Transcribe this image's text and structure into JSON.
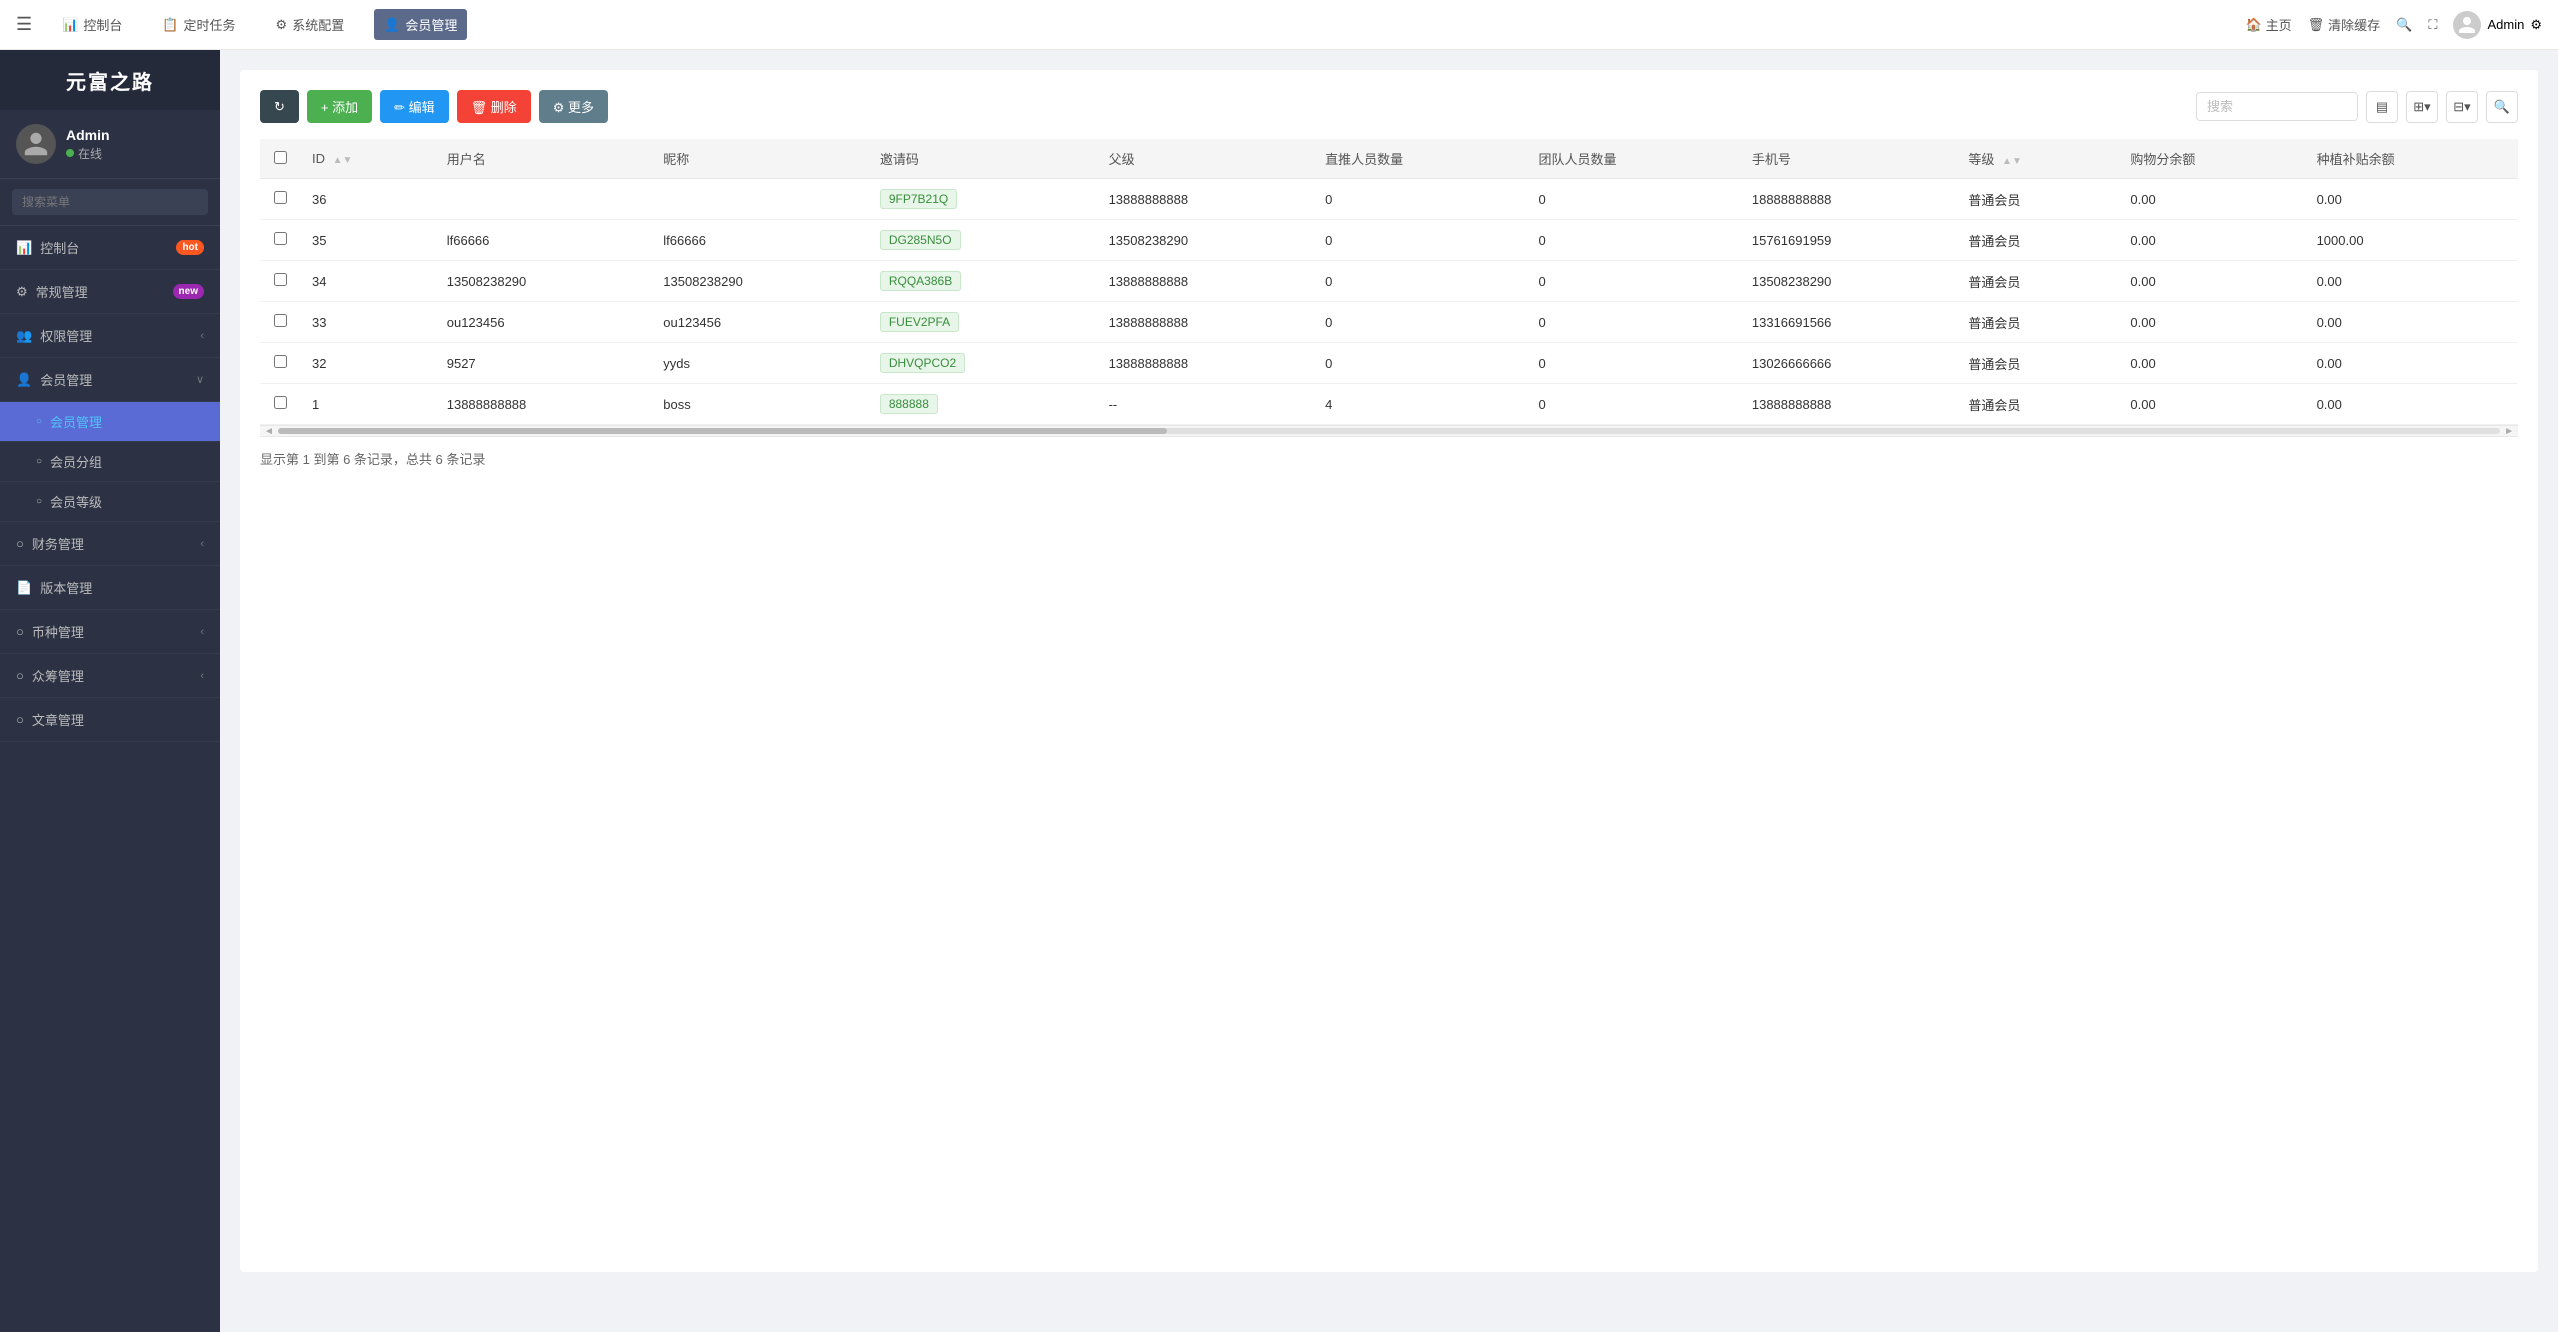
{
  "app": {
    "logo": "元富之路",
    "user": {
      "name": "Admin",
      "status": "在线"
    }
  },
  "topNav": {
    "hamburger": "☰",
    "items": [
      {
        "id": "dashboard",
        "icon": "📊",
        "label": "控制台"
      },
      {
        "id": "cron",
        "icon": "📋",
        "label": "定时任务"
      },
      {
        "id": "config",
        "icon": "⚙",
        "label": "系统配置"
      },
      {
        "id": "member",
        "icon": "👤",
        "label": "会员管理",
        "active": true
      }
    ],
    "right": [
      {
        "id": "home",
        "icon": "🏠",
        "label": "主页"
      },
      {
        "id": "clear",
        "icon": "🗑",
        "label": "清除缓存"
      },
      {
        "id": "extra1",
        "icon": "🔍",
        "label": ""
      },
      {
        "id": "expand",
        "icon": "⛶",
        "label": ""
      }
    ],
    "admin": "Admin"
  },
  "sidebar": {
    "searchPlaceholder": "搜索菜单",
    "items": [
      {
        "id": "dashboard",
        "icon": "📊",
        "label": "控制台",
        "badge": "hot",
        "badgeText": "hot",
        "hasArrow": false
      },
      {
        "id": "general",
        "icon": "⚙",
        "label": "常规管理",
        "badge": "new",
        "badgeText": "new",
        "hasArrow": false
      },
      {
        "id": "permission",
        "icon": "👥",
        "label": "权限管理",
        "hasArrow": true
      },
      {
        "id": "member-mgmt",
        "icon": "👤",
        "label": "会员管理",
        "hasArrow": true,
        "expanded": true
      },
      {
        "id": "finance",
        "icon": "○",
        "label": "财务管理",
        "hasArrow": true
      },
      {
        "id": "version",
        "icon": "📄",
        "label": "版本管理",
        "hasArrow": false
      },
      {
        "id": "currency",
        "icon": "○",
        "label": "币种管理",
        "hasArrow": true
      },
      {
        "id": "crowdfunding",
        "icon": "○",
        "label": "众筹管理",
        "hasArrow": true
      },
      {
        "id": "article",
        "icon": "○",
        "label": "文章管理",
        "hasArrow": false
      }
    ],
    "subItems": [
      {
        "id": "member-list",
        "label": "会员管理",
        "active": true
      },
      {
        "id": "member-group",
        "label": "会员分组",
        "active": false
      },
      {
        "id": "member-level",
        "label": "会员等级",
        "active": false
      }
    ]
  },
  "toolbar": {
    "refreshLabel": "",
    "addLabel": "+ 添加",
    "editLabel": "✏ 编辑",
    "deleteLabel": "🗑 删除",
    "moreLabel": "⚙ 更多",
    "searchPlaceholder": "搜索"
  },
  "table": {
    "columns": [
      {
        "id": "checkbox",
        "label": ""
      },
      {
        "id": "id",
        "label": "ID",
        "sortable": true
      },
      {
        "id": "username",
        "label": "用户名"
      },
      {
        "id": "nickname",
        "label": "昵称"
      },
      {
        "id": "inviteCode",
        "label": "邀请码"
      },
      {
        "id": "parent",
        "label": "父级"
      },
      {
        "id": "directCount",
        "label": "直推人员数量"
      },
      {
        "id": "teamCount",
        "label": "团队人员数量"
      },
      {
        "id": "phone",
        "label": "手机号"
      },
      {
        "id": "level",
        "label": "等级",
        "sortable": true
      },
      {
        "id": "shopBalance",
        "label": "购物分余额"
      },
      {
        "id": "plantBalance",
        "label": "种植补贴余额"
      }
    ],
    "rows": [
      {
        "id": "36",
        "username": "",
        "nickname": "",
        "inviteCode": "9FP7B21Q",
        "inviteCodeStyle": "code-green",
        "parent": "13888888888",
        "directCount": "0",
        "teamCount": "0",
        "phone": "18888888888",
        "level": "普通会员",
        "shopBalance": "0.00",
        "plantBalance": "0.00"
      },
      {
        "id": "35",
        "username": "lf66666",
        "nickname": "lf66666",
        "inviteCode": "DG285N5O",
        "inviteCodeStyle": "code-green",
        "parent": "13508238290",
        "directCount": "0",
        "teamCount": "0",
        "phone": "15761691959",
        "level": "普通会员",
        "shopBalance": "0.00",
        "plantBalance": "1000.00"
      },
      {
        "id": "34",
        "username": "13508238290",
        "nickname": "13508238290",
        "inviteCode": "RQQA386B",
        "inviteCodeStyle": "code-green",
        "parent": "13888888888",
        "directCount": "0",
        "teamCount": "0",
        "phone": "13508238290",
        "level": "普通会员",
        "shopBalance": "0.00",
        "plantBalance": "0.00"
      },
      {
        "id": "33",
        "username": "ou123456",
        "nickname": "ou123456",
        "inviteCode": "FUEV2PFA",
        "inviteCodeStyle": "code-green",
        "parent": "13888888888",
        "directCount": "0",
        "teamCount": "0",
        "phone": "13316691566",
        "level": "普通会员",
        "shopBalance": "0.00",
        "plantBalance": "0.00"
      },
      {
        "id": "32",
        "username": "9527",
        "nickname": "yyds",
        "inviteCode": "DHVQPCO2",
        "inviteCodeStyle": "code-green",
        "parent": "13888888888",
        "directCount": "0",
        "teamCount": "0",
        "phone": "13026666666",
        "level": "普通会员",
        "shopBalance": "0.00",
        "plantBalance": "0.00"
      },
      {
        "id": "1",
        "username": "13888888888",
        "nickname": "boss",
        "inviteCode": "888888",
        "inviteCodeStyle": "code-special",
        "parent": "--",
        "directCount": "4",
        "teamCount": "0",
        "phone": "13888888888",
        "level": "普通会员",
        "shopBalance": "0.00",
        "plantBalance": "0.00"
      }
    ],
    "pagination": "显示第 1 到第 6 条记录，总共 6 条记录"
  }
}
